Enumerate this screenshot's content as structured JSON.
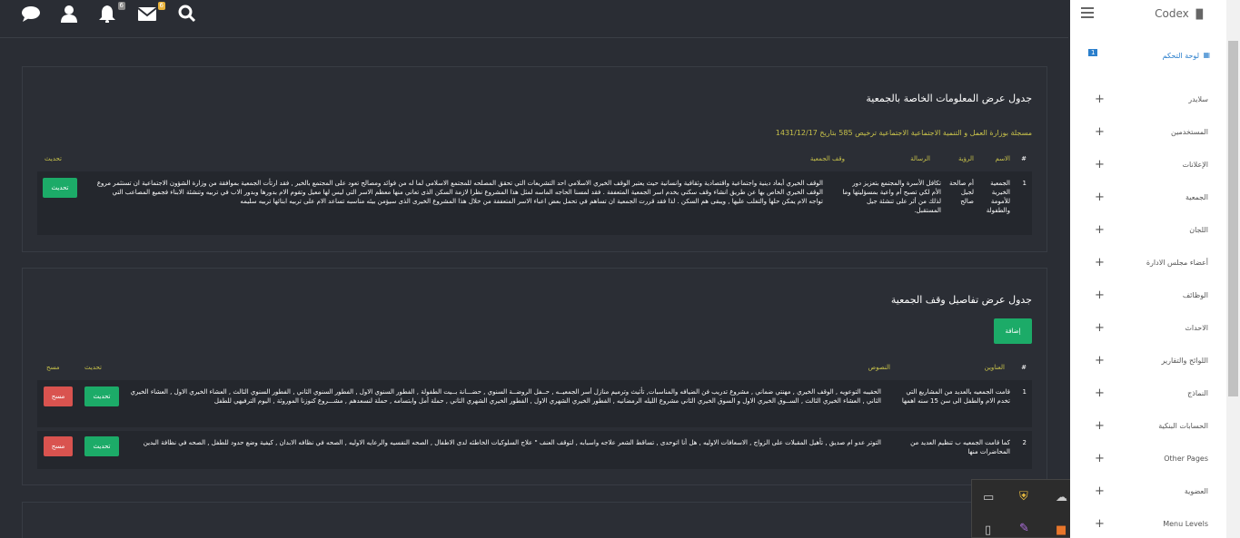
{
  "topbar": {
    "notif_count": "6",
    "mail_count": "6"
  },
  "panel1": {
    "title": "جدول عرض المعلومات الخاصة بالجمعية",
    "subtitle": "مسجلة بوزارة العمل و التنمية الاجتماعية الاجتماعية ترخيص 585 بتاريخ 1431/12/17",
    "headers": {
      "num": "#",
      "name": "الاسم",
      "vision": "الرؤية",
      "mission": "الرسالة",
      "waqf": "وقف الجمعية",
      "update": "تحديث"
    },
    "row": {
      "num": "1",
      "name": "الجمعية الخيرية للأمومة والطفولة",
      "vision": "أم صالحة لجيل صالح",
      "mission": "تكافل الأسرة والمجتمع بتعزيز دور الأم لكي تصبح أم واعية بمسؤليتها وما لذلك من أثر على تنشئة جيل المستقبل.",
      "waqf": "الوقف الخيري أبعاد دينية واجتماعية واقتصادية وثقافية وانسانية حيث يعتبر الوقف الخيري الاسلامي احد التشريعات التي تحقق المصلحه للمجتمع الاسلامي لما له من فوائد ومصالح تعود على المجتمع بالخير , فقد ارتأت الجمعية بموافقة من وزارة الشؤون الاجتماعية ان تستثمر مروع الوقف الخيري الخاص بها عن طريق انشاء وقف سكني يخدم اسر الجمعية المتعففة . فقد لمسنا الحاجه الماسه لمثل هذا المشروع نظرا لازمة السكن الذى تعاني منها معظم الاسر التي ليس لها معيل وتقوم الام بدورها وبدور الاب في تربيه وتنشئة الابناء فجميع المصاعب التي تواجه الام يمكن حلها والتغلب عليها , ويبقى هم السكن . لذا فقد قررت الجمعية ان تساهم في تحمل بعض اعباء الاسر المتعففة من خلال هذا المشروع الخيرى الذى سيؤمن بيئه مناسبه تساعد الام على تربيه ابنائها تربيه سليمه",
      "update_btn": "تحديث"
    }
  },
  "panel2": {
    "title": "جدول عرض تفاصيل وقف الجمعية",
    "add_btn": "إضافة",
    "headers": {
      "num": "#",
      "address": "العناوين",
      "texts": "النصوص",
      "update": "تحديث",
      "delete": "مسح"
    },
    "rows": [
      {
        "num": "1",
        "address": "قامت الجمعيه بالعديد من المشاريع التي تخدم الام والطفل الى سن 15 سنه اهمها",
        "texts": "الحقيبه التوعويه , الوقف الخيري , مهنتي ضماني , مشروع تدريب فن الضيافه والمناسبات, تأثيث وترميم منازل أسر الجمعيــه , حــفل الروضــة السنوي , حضـــانة بــيت الطفولة , الفطور السنوي الاول , الفطور السنوي الثاني , الفطور السنوي الثالث , العشاء الخيري الاول , العشاء الخيري الثاني , العشاء الخيري الثالث , الســوق الخيري الاول و السوق الخيري الثاني مشروع الليله الرمضانيه , الفطور الخيري الشهري الاول , الفطور الخيري الشهري الثاني , حملة أمل وابتسامه , حملة لنسعدهم , مشـــروع كنوزنا الموروثة , اليوم الترفيهي للطفل",
        "update_btn": "تحديث",
        "delete_btn": "مسح"
      },
      {
        "num": "2",
        "address": "كما قامت الجمعيه ب تنظيم العديد من المحاضرات منها",
        "texts": "التوتر عدو ام صديق , تأهيل المقبلات على الزواج , الاسعافات الاوليه , هل أنا اتوحدى , تساقط الشعر علاجه واسبابه , لتوقف العنف \" علاج السلوكيات الخاطئه لدى الاطفال , الصحه النفسيه والرعايه الاوليه , الصحه في نظافه الابدان , كيفية وضع حدود للطفل , الصحه في نظافة البدين",
        "update_btn": "تحديث",
        "delete_btn": "مسح"
      }
    ]
  },
  "sidebar": {
    "brand": "Codex",
    "dashboard_label": "لوحة التحكم",
    "dashboard_badge": "1",
    "items": [
      {
        "label": "سلايدر"
      },
      {
        "label": "المستخدمين"
      },
      {
        "label": "الإعلانات"
      },
      {
        "label": "الجمعية"
      },
      {
        "label": "اللجان"
      },
      {
        "label": "أعضاء مجلس الادارة"
      },
      {
        "label": "الوظائف"
      },
      {
        "label": "الاحداث"
      },
      {
        "label": "اللوائح والتقارير"
      },
      {
        "label": "النماذج"
      },
      {
        "label": "الحسابات البنكية"
      },
      {
        "label": "Other Pages"
      },
      {
        "label": "العضوية"
      },
      {
        "label": "Menu Levels"
      }
    ]
  },
  "colors": {
    "accent_green": "#1cab68",
    "danger_red": "#d9534f",
    "label_yellow": "#c8c24a",
    "badge_orange": "#e8b23a"
  }
}
